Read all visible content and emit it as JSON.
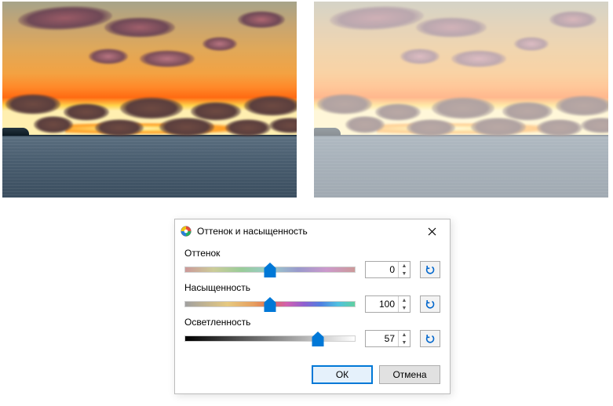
{
  "images": {
    "left_desc": "original-sunset-sea",
    "right_desc": "lightened-sunset-sea"
  },
  "dialog": {
    "title": "Оттенок и насыщенность",
    "close_label": "Close",
    "sliders": {
      "hue": {
        "label": "Оттенок",
        "value": 0,
        "min": -180,
        "max": 180,
        "percent": 50
      },
      "sat": {
        "label": "Насыщенность",
        "value": 100,
        "min": 0,
        "max": 200,
        "percent": 50
      },
      "light": {
        "label": "Осветленность",
        "value": 57,
        "min": -100,
        "max": 100,
        "percent": 78
      }
    },
    "reset_tooltip": "Сброс",
    "ok_label": "ОК",
    "cancel_label": "Отмена"
  }
}
